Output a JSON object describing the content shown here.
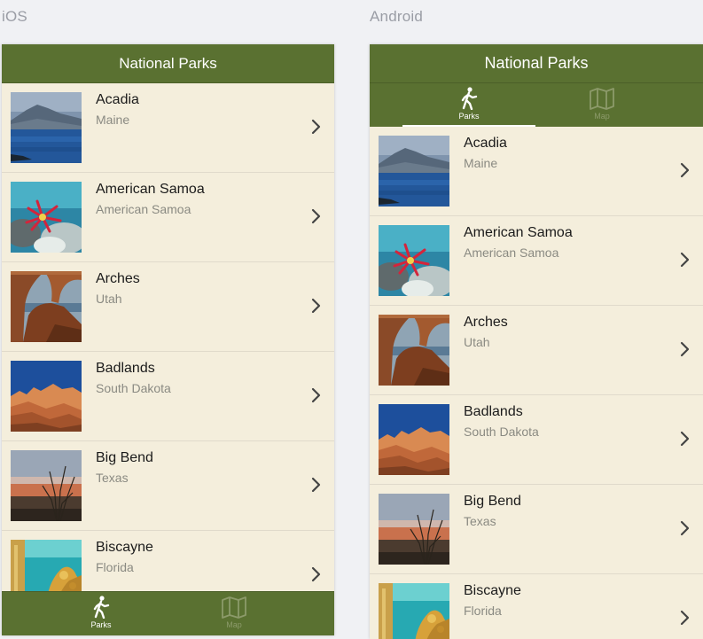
{
  "labels": {
    "ios": "iOS",
    "android": "Android"
  },
  "app": {
    "title": "National Parks"
  },
  "tabs": [
    {
      "label": "Parks",
      "icon": "hiker-icon",
      "active": true
    },
    {
      "label": "Map",
      "icon": "map-icon",
      "active": false
    }
  ],
  "parks": [
    {
      "name": "Acadia",
      "state": "Maine",
      "thumb": "acadia"
    },
    {
      "name": "American Samoa",
      "state": "American Samoa",
      "thumb": "samoa"
    },
    {
      "name": "Arches",
      "state": "Utah",
      "thumb": "arches"
    },
    {
      "name": "Badlands",
      "state": "South Dakota",
      "thumb": "badlands"
    },
    {
      "name": "Big Bend",
      "state": "Texas",
      "thumb": "bigbend"
    },
    {
      "name": "Biscayne",
      "state": "Florida",
      "thumb": "biscayne"
    }
  ],
  "colors": {
    "bar": "#5a7131",
    "background": "#f4eedc",
    "tab_inactive": "#8c9a6a"
  }
}
